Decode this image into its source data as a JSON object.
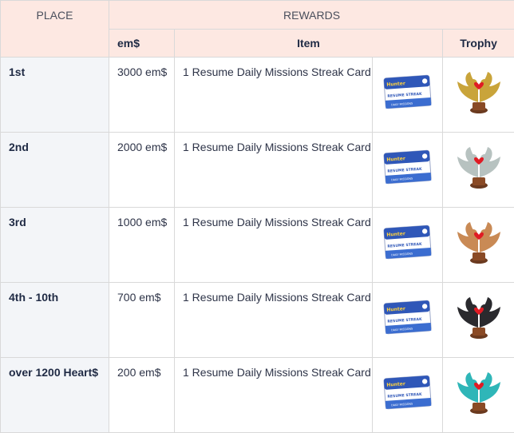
{
  "header": {
    "place": "PLACE",
    "rewards": "REWARDS",
    "em": "em$",
    "item": "Item",
    "trophy": "Trophy"
  },
  "rows": [
    {
      "place": "1st",
      "em": "3000 em$",
      "item": "1 Resume Daily Missions Streak Card",
      "trophy_color": "#c9a43a"
    },
    {
      "place": "2nd",
      "em": "2000 em$",
      "item": "1 Resume Daily Missions Streak Card",
      "trophy_color": "#b7c2c0"
    },
    {
      "place": "3rd",
      "em": "1000 em$",
      "item": "1 Resume Daily Missions Streak Card",
      "trophy_color": "#c98a55"
    },
    {
      "place": "4th - 10th",
      "em": "700 em$",
      "item": "1 Resume Daily Missions Streak Card",
      "trophy_color": "#2a2a2e"
    },
    {
      "place": "over 1200 Heart$",
      "em": "200 em$",
      "item": "1 Resume Daily Missions Streak Card",
      "trophy_color": "#2fb6b8"
    }
  ],
  "card": {
    "brand": "Hunter",
    "line1": "RESUME STREAK",
    "line2": "DAILY MISSIONS"
  }
}
